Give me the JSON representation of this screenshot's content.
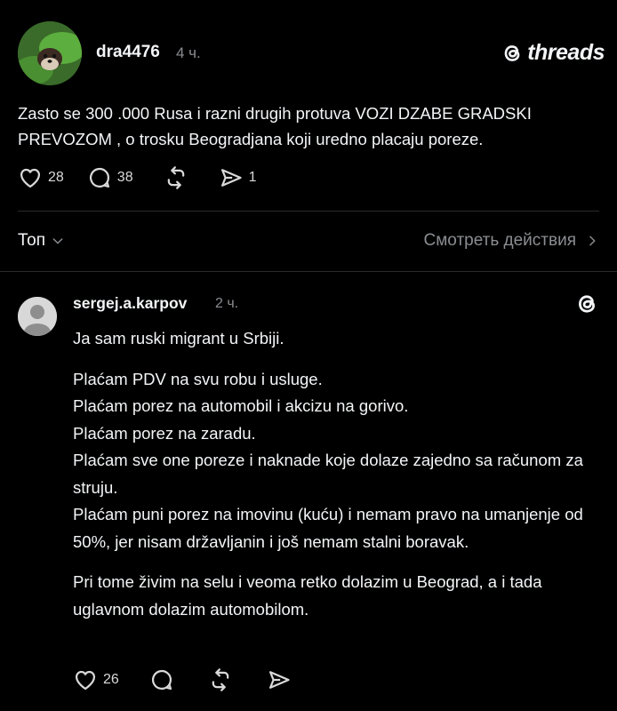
{
  "post": {
    "username": "dra4476",
    "time": "4 ч.",
    "brand": "threads",
    "text": "Zasto se 300 .000 Rusa i razni drugih protuva VOZI DZABE GRADSKI PREVOZOM , o trosku Beogradjana koji uredno placaju poreze.",
    "likes": "28",
    "comments": "38",
    "shares": "1"
  },
  "sort_label": "Топ",
  "activity_label": "Смотреть действия",
  "reply": {
    "username": "sergej.a.karpov",
    "time": "2 ч.",
    "intro": "Ja sam ruski migrant u Srbiji.",
    "lines": [
      "Plaćam PDV na svu robu i usluge.",
      "Plaćam porez na automobil i akcizu na gorivo.",
      "Plaćam porez na zaradu.",
      "Plaćam sve one poreze i naknade koje dolaze zajedno sa računom za struju.",
      "Plaćam puni porez na imovinu (kuću) i nemam pravo na umanjenje od 50%, jer nisam državljanin i još nemam stalni boravak."
    ],
    "closing": "Pri tome živim na selu i veoma retko dolazim u Beograd, a i tada uglavnom dolazim automobilom.",
    "likes": "26"
  },
  "icons": {
    "heart": "heart-icon",
    "comment": "comment-icon",
    "repost": "repost-icon",
    "share": "share-icon",
    "threads": "threads-logo-icon",
    "chevron_down": "chevron-down-icon",
    "chevron_right": "chevron-right-icon"
  }
}
